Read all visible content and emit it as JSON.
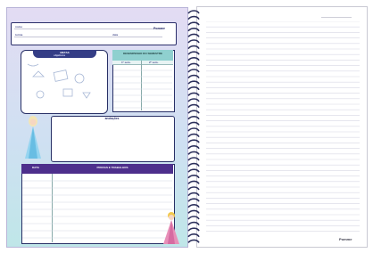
{
  "brand": "Pomme",
  "header": {
    "name_label": "nome",
    "class_label": "turma",
    "date_label": "data"
  },
  "goals": {
    "title": "METAS",
    "subtitle": "objetivos"
  },
  "table": {
    "title": "DESEMPENHO DO SEMESTRE",
    "col1": "1º sem.",
    "col2": "2º sem."
  },
  "notes": {
    "title": "anotações"
  },
  "schedule": {
    "col1": "DATA",
    "col2": "PROVAS E TRABALHOS"
  },
  "colors": {
    "navy": "#283066",
    "purple": "#4d2f8c",
    "teal": "#8fd0cf",
    "pink": "#e78fb8"
  },
  "icons": [
    "spiral-binding-icon",
    "ice-princess-icon",
    "pink-princess-icon",
    "doodle-icons"
  ]
}
